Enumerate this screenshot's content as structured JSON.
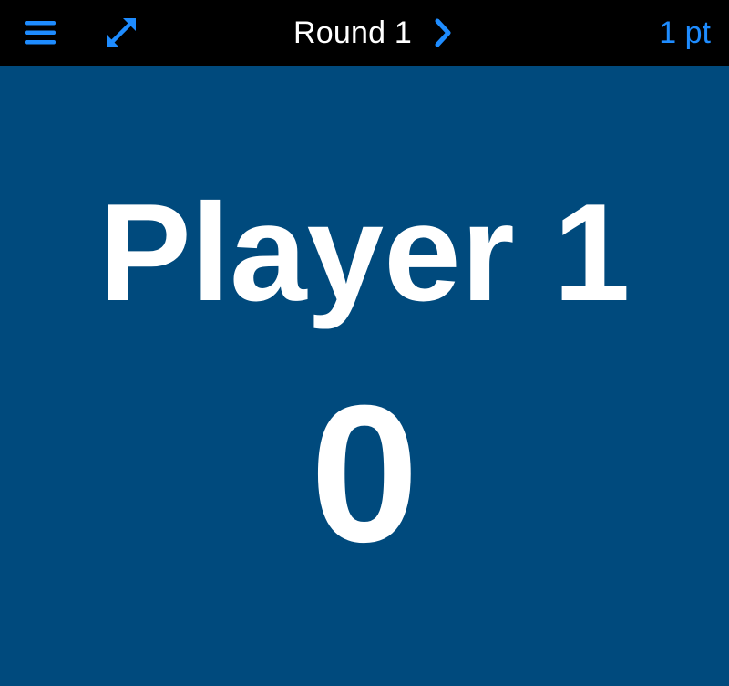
{
  "toolbar": {
    "menu_icon": "hamburger-menu-icon",
    "expand_icon": "expand-arrows-icon",
    "round_title": "Round 1",
    "next_icon": "chevron-right-icon",
    "points_label": "1 pt",
    "accent_color": "#1e8cff",
    "background_color": "#000000"
  },
  "player": {
    "name": "Player 1",
    "score": "0",
    "panel_color": "#004a7d"
  }
}
